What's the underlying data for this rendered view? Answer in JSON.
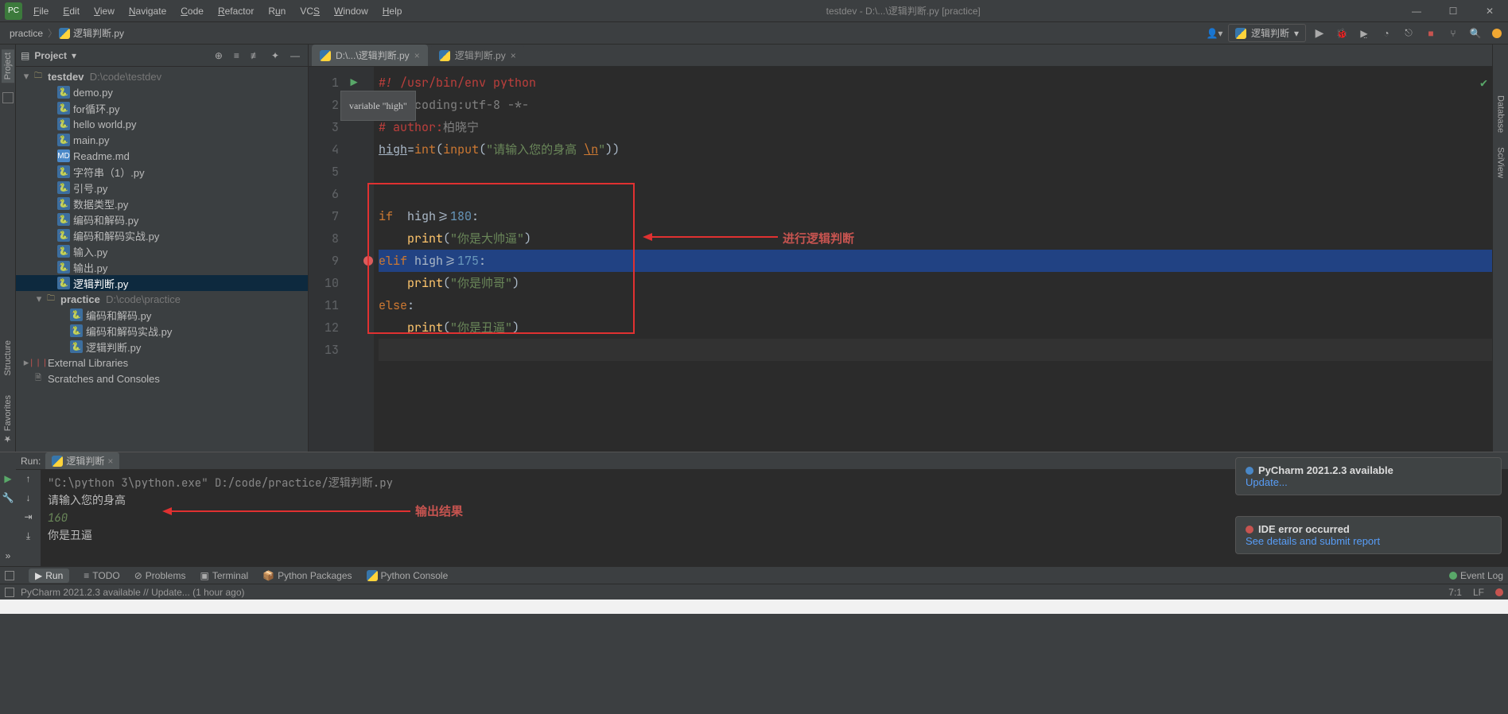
{
  "titlebar": {
    "project": "testdev",
    "path": "D:\\...\\逻辑判断.py",
    "suffix": "[practice]"
  },
  "menu": [
    "File",
    "Edit",
    "View",
    "Navigate",
    "Code",
    "Refactor",
    "Run",
    "VCS",
    "Window",
    "Help"
  ],
  "breadcrumb": {
    "a": "practice",
    "b": "逻辑判断.py"
  },
  "runconfig": {
    "label": "逻辑判断"
  },
  "project_panel": {
    "title": "Project",
    "root": {
      "name": "testdev",
      "path": "D:\\code\\testdev"
    },
    "files_root": [
      "demo.py",
      "for循环.py",
      "hello world.py",
      "main.py",
      "Readme.md",
      "字符串（1）.py",
      "引号.py",
      "数据类型.py",
      "编码和解码.py",
      "编码和解码实战.py",
      "输入.py",
      "输出.py",
      "逻辑判断.py"
    ],
    "pkg": {
      "name": "practice",
      "path": "D:\\code\\practice"
    },
    "files_pkg": [
      "编码和解码.py",
      "编码和解码实战.py",
      "逻辑判断.py"
    ],
    "ext": "External Libraries",
    "scratch": "Scratches and Consoles"
  },
  "tabs": [
    {
      "label": "D:\\...\\逻辑判断.py",
      "active": true
    },
    {
      "label": "逻辑判断.py",
      "active": false
    }
  ],
  "tooltip": "variable \"high\"",
  "code": {
    "lines": 13,
    "l1": "#! /usr/bin/env python",
    "l2_a": "# -*-",
    "l2_b": "coding:utf-8 -*-",
    "l3_a": "# author:",
    "l3_b": "柏晓宁",
    "l4_a": "high",
    "l4_b": "=",
    "l4_c": "int",
    "l4_d": "(",
    "l4_e": "input",
    "l4_f": "(",
    "l4_g": "\"请输入您的身高 ",
    "l4_h": "\\n",
    "l4_i": "\"",
    "l4_j": "))",
    "l7_a": "if",
    "l7_b": "  high>=",
    "l7_c": "180",
    "l7_d": ":",
    "l8_a": "print",
    "l8_b": "(",
    "l8_c": "\"你是大帅逼\"",
    "l8_d": ")",
    "l9_a": "elif",
    "l9_b": " high>=",
    "l9_c": "175",
    "l9_d": ":",
    "l10_a": "print",
    "l10_b": "(",
    "l10_c": "\"你是帅哥\"",
    "l10_d": ")",
    "l11_a": "else",
    "l11_b": ":",
    "l12_a": "print",
    "l12_b": "(",
    "l12_c": "\"你是丑逼\"",
    "l12_d": ")"
  },
  "annotations": {
    "a1": "进行逻辑判断",
    "a2": "输出结果"
  },
  "run": {
    "header_label": "Run:",
    "tab": "逻辑判断",
    "line1": "\"C:\\python 3\\python.exe\" D:/code/practice/逻辑判断.py",
    "line2": "请输入您的身高",
    "line3": "160",
    "line4": "你是丑逼"
  },
  "notifications": {
    "n1_title": "PyCharm 2021.2.3 available",
    "n1_link": "Update...",
    "n2_title": "IDE error occurred",
    "n2_link": "See details and submit report"
  },
  "bottom_tabs": [
    "Run",
    "TODO",
    "Problems",
    "Terminal",
    "Python Packages",
    "Python Console"
  ],
  "event_log": "Event Log",
  "status": {
    "msg": "PyCharm 2021.2.3 available // Update... (1 hour ago)",
    "pos": "7:1",
    "enc": "LF"
  }
}
